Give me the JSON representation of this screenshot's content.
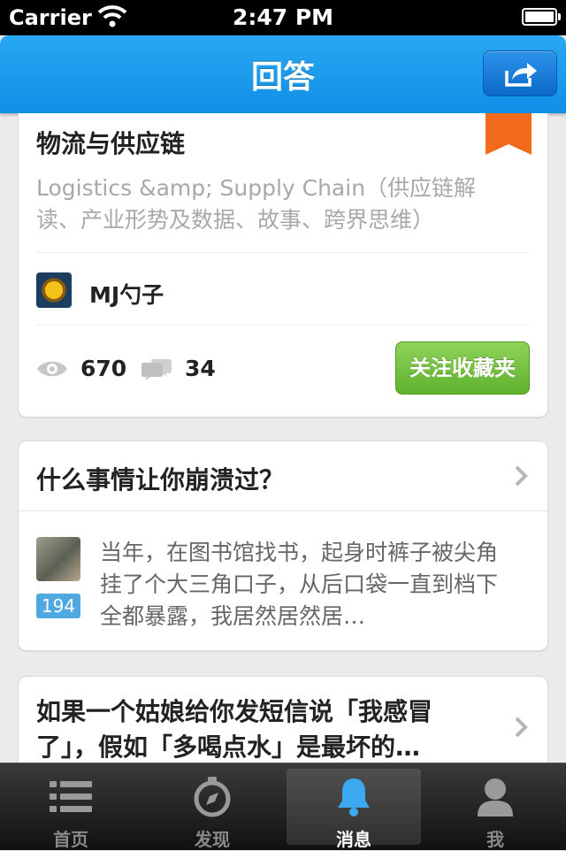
{
  "status_bar": {
    "carrier": "Carrier",
    "time": "2:47 PM",
    "battery_level": 0.9
  },
  "nav": {
    "title": "回答",
    "share_icon": "share-icon"
  },
  "topic_card": {
    "title": "物流与供应链",
    "description": "Logistics &amp; Supply Chain（供应链解读、产业形势及数据、故事、跨界思维）",
    "author": "MJ勺子",
    "views": "670",
    "comments": "34",
    "follow_label": "关注收藏夹",
    "accent_color": "#f26b1d"
  },
  "question_card": {
    "title": "什么事情让你崩溃过？",
    "votes": "194",
    "answer": "当年，在图书馆找书，起身时裤子被尖角挂了个大三角口子，从后口袋一直到档下全都暴露，我居然居然居…"
  },
  "question_card_2": {
    "title": "如果一个姑娘给你发短信说「我感冒了」，假如「多喝点水」是最坏的…"
  },
  "tab_bar": {
    "tabs": [
      {
        "label": "首页",
        "icon": "list-icon"
      },
      {
        "label": "发现",
        "icon": "compass-icon"
      },
      {
        "label": "消息",
        "icon": "bell-icon"
      },
      {
        "label": "我",
        "icon": "person-icon"
      }
    ],
    "selected_index": 2,
    "selected_color": "#3aa9f0"
  }
}
